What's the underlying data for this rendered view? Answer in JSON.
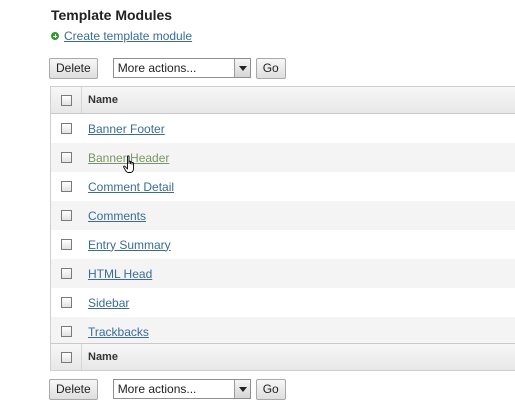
{
  "page": {
    "title": "Template Modules",
    "create_link": "Create template module"
  },
  "actions": {
    "delete_label": "Delete",
    "more_actions_value": "More actions...",
    "go_label": "Go"
  },
  "table": {
    "header_name": "Name",
    "footer_name": "Name",
    "rows": [
      {
        "name": "Banner Footer"
      },
      {
        "name": "Banner Header"
      },
      {
        "name": "Comment Detail"
      },
      {
        "name": "Comments"
      },
      {
        "name": "Entry Summary"
      },
      {
        "name": "HTML Head"
      },
      {
        "name": "Sidebar"
      },
      {
        "name": "Trackbacks"
      }
    ]
  },
  "colors": {
    "link": "#3a6c96",
    "hovered_link": "#7c9463",
    "create_icon": "#2f9a2f"
  },
  "icons": {
    "create": "plus-circle-icon",
    "cursor": "hand-pointer-icon"
  }
}
